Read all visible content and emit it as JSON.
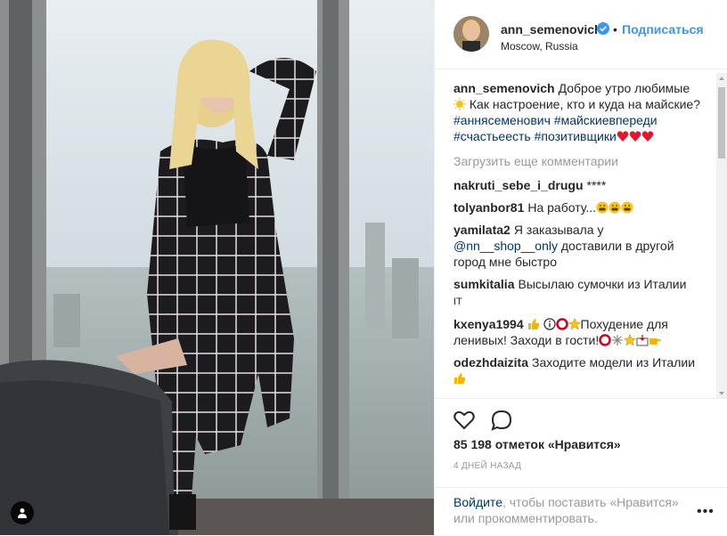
{
  "post": {
    "username": "ann_semenovich",
    "follow_label": "Подписаться",
    "separator": "•",
    "location": "Moscow, Russia",
    "caption_text_1": "Доброе утро любимые",
    "caption_text_2": "Как настроение, кто и куда на майские?",
    "hashtags": [
      "#аннясеменович",
      "#майскиевпереди",
      "#счастьеесть",
      "#позитивщики"
    ],
    "load_more": "Загрузить еще комментарии",
    "comments": [
      {
        "user": "nakruti_sebe_i_drugu",
        "text": "****"
      },
      {
        "user": "tolyanbor81",
        "text": "На работу..."
      },
      {
        "user": "yamilata2",
        "text_before": "Я заказывала у",
        "mention": "@nn__shop__only",
        "text_after": "доставили в другой город мне быстро"
      },
      {
        "user": "sumkitalia",
        "text": "Высылаю сумочки из Италии",
        "text2": "IT"
      },
      {
        "user": "kxenya1994",
        "text_a": "Похудение для",
        "text_b": "ленивых! Заходи в гости!"
      },
      {
        "user": "odezhdaizita",
        "text": "Заходите модели из Италии"
      }
    ],
    "likes": "85 198 отметок «Нравится»",
    "time_ago": "4 ДНЕЙ НАЗАД",
    "login_link": "Войдите",
    "login_text": ", чтобы поставить «Нравится» или прокомментировать.",
    "more_options": "•••"
  },
  "icons": {
    "like": "heart-icon",
    "comment": "comment-icon",
    "verified": "verified-badge-icon",
    "tag": "user-tag-icon"
  },
  "colors": {
    "accent": "#3897f0",
    "link": "#003569",
    "muted": "#999999",
    "heart": "#e0182d"
  }
}
